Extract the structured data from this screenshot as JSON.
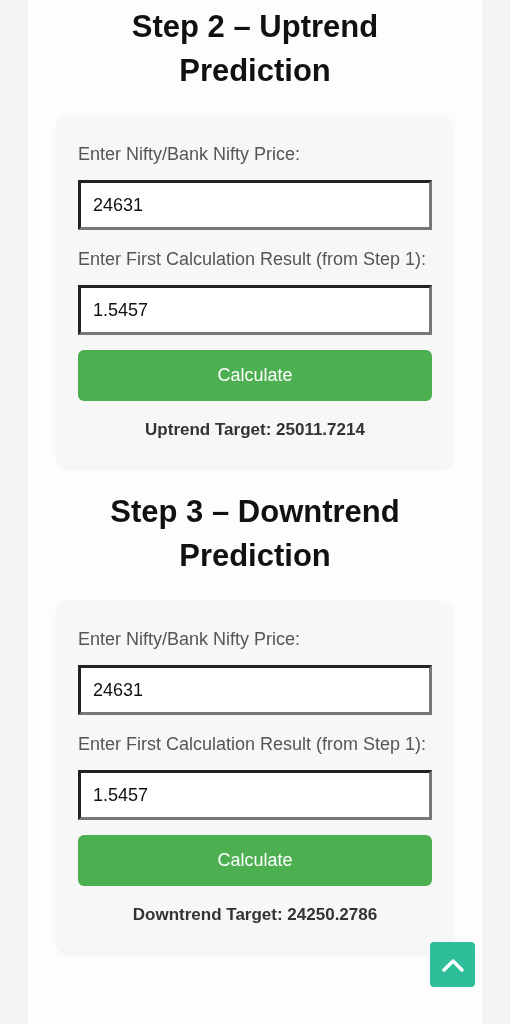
{
  "sections": [
    {
      "heading": "Step 2 – Uptrend Prediction",
      "fields": [
        {
          "label": "Enter Nifty/Bank Nifty Price:",
          "value": "24631"
        },
        {
          "label": "Enter First Calculation Result (from Step 1):",
          "value": "1.5457"
        }
      ],
      "button": "Calculate",
      "result": "Uptrend Target: 25011.7214"
    },
    {
      "heading": "Step 3 – Downtrend Prediction",
      "fields": [
        {
          "label": "Enter Nifty/Bank Nifty Price:",
          "value": "24631"
        },
        {
          "label": "Enter First Calculation Result (from Step 1):",
          "value": "1.5457"
        }
      ],
      "button": "Calculate",
      "result": "Downtrend Target: 24250.2786"
    }
  ]
}
